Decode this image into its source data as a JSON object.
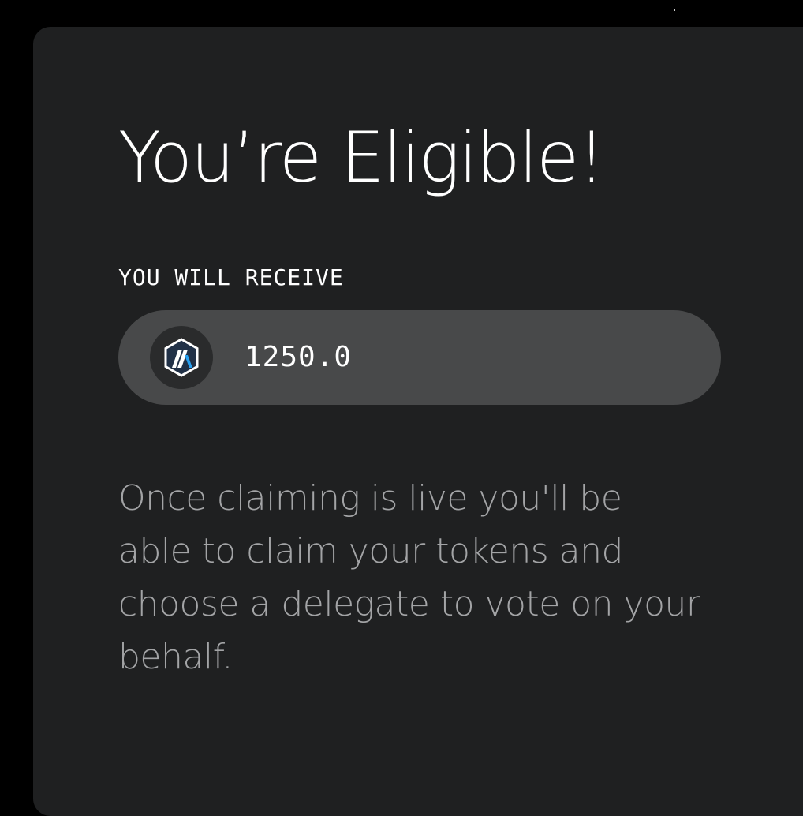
{
  "header": {
    "title": "You’re Eligible!"
  },
  "receive": {
    "label": "YOU WILL RECEIVE",
    "token_icon": "arbitrum-logo-icon",
    "amount": "1250.0"
  },
  "info": {
    "text": "Once claiming is live you'll be able to claim your tokens and choose a delegate to vote on your behalf."
  },
  "colors": {
    "background": "#000000",
    "card": "#1f2021",
    "pill": "#48494a",
    "title_text": "#ffffff",
    "body_text": "#a3a4a6",
    "token_blue": "#28a0f0",
    "token_navy": "#213147"
  }
}
